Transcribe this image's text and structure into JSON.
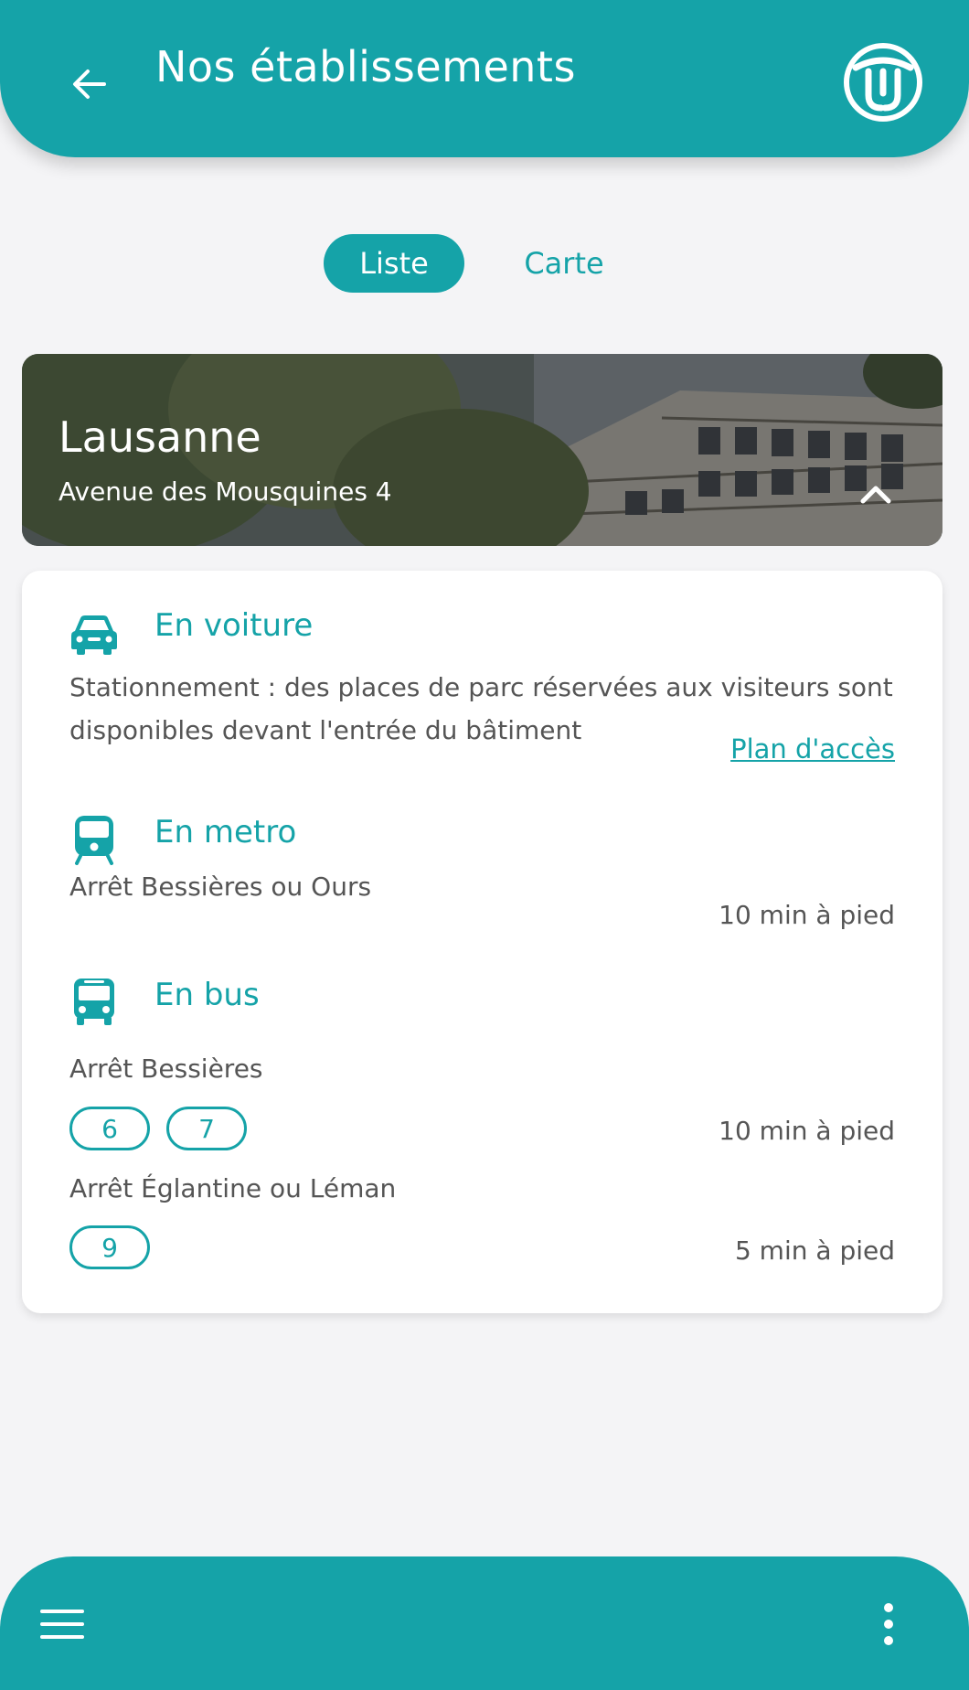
{
  "header": {
    "title": "Nos établissements",
    "back_icon": "arrow-left-icon",
    "logo_icon": "company-logo-icon"
  },
  "view_toggle": {
    "list_label": "Liste",
    "map_label": "Carte",
    "selected": "Liste"
  },
  "location": {
    "city": "Lausanne",
    "address": "Avenue des Mousquines 4",
    "expand_icon": "chevron-up-icon"
  },
  "access": {
    "car": {
      "title": "En voiture",
      "icon": "car-icon",
      "description_line1": "Stationnement : des places de parc réservées aux visiteurs sont",
      "description_line2": "disponibles devant l'entrée du bâtiment",
      "link": "Plan d'accès"
    },
    "metro": {
      "title": "En metro",
      "icon": "train-icon",
      "stop": "Arrêt Bessières ou Ours",
      "walk": "10 min à pied"
    },
    "bus": {
      "title": "En bus",
      "icon": "bus-icon",
      "stops": [
        {
          "name": "Arrêt Bessières",
          "lines": [
            "6",
            "7"
          ],
          "walk": "10 min à pied"
        },
        {
          "name": "Arrêt Églantine ou Léman",
          "lines": [
            "9"
          ],
          "walk": "5 min à pied"
        }
      ]
    }
  },
  "bottom_nav": {
    "menu_icon": "hamburger-menu-icon",
    "more_icon": "more-vertical-icon"
  },
  "colors": {
    "accent": "#15a3a8",
    "background": "#f4f4f6",
    "card": "#ffffff"
  }
}
